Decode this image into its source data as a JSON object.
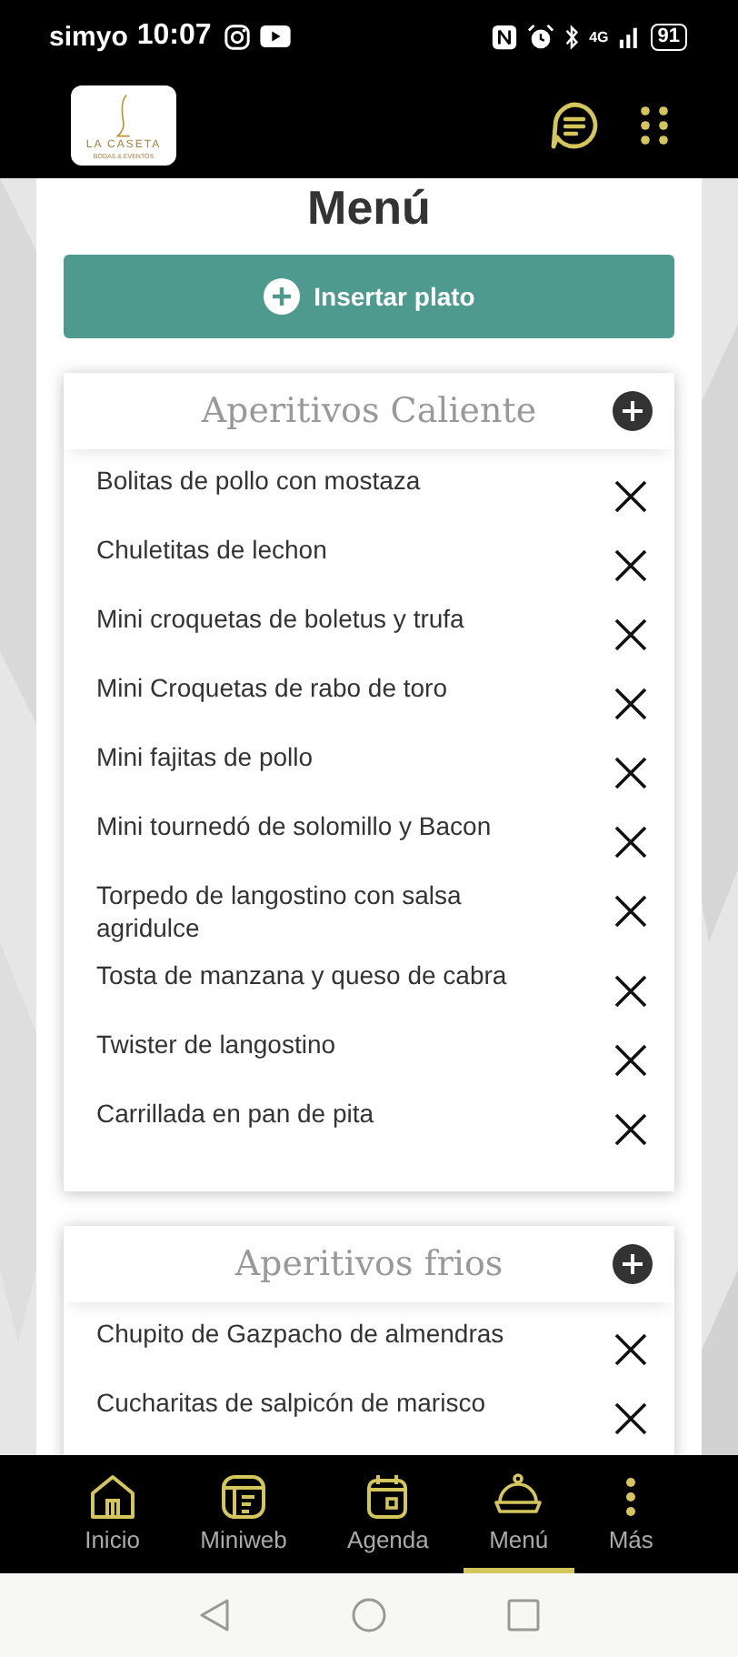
{
  "status_bar": {
    "carrier": "simyo",
    "time": "10:07",
    "network": "4G",
    "battery": "91"
  },
  "header": {
    "logo_title": "LA CASETA",
    "logo_subtitle": "BODAS & EVENTOS"
  },
  "page_title": "Menú",
  "add_button": {
    "label": "Insertar plato"
  },
  "sections": [
    {
      "title": "Aperitivos Caliente",
      "items": [
        "Bolitas de pollo con mostaza",
        "Chuletitas de lechon",
        "Mini croquetas de boletus y trufa",
        "Mini Croquetas de rabo de toro",
        "Mini fajitas de pollo",
        "Mini tournedó de solomillo y Bacon",
        "Torpedo de langostino con salsa agridulce",
        "Tosta de manzana y queso de cabra",
        "Twister de langostino",
        "Carrillada en pan de pita"
      ]
    },
    {
      "title": "Aperitivos frios",
      "items": [
        "Chupito de Gazpacho de almendras",
        "Cucharitas de salpicón de marisco"
      ]
    }
  ],
  "bottom_nav": [
    {
      "kind": "home",
      "label": "Inicio",
      "selected": false
    },
    {
      "kind": "web",
      "label": "Miniweb",
      "selected": false
    },
    {
      "kind": "calendar",
      "label": "Agenda",
      "selected": false
    },
    {
      "kind": "cloche",
      "label": "Menú",
      "selected": true
    },
    {
      "kind": "more",
      "label": "Más",
      "selected": false
    }
  ]
}
